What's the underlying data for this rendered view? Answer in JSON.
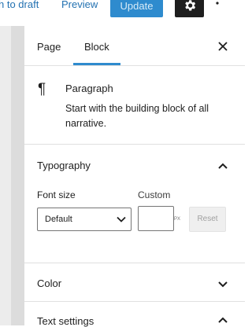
{
  "topbar": {
    "switch_to_draft": "h to draft",
    "preview": "Preview",
    "update": "Update",
    "settings_icon": "gear-icon",
    "more_icon": "vertical-ellipsis-icon"
  },
  "tabs": {
    "page": "Page",
    "block": "Block",
    "close_icon": "close-icon"
  },
  "block_card": {
    "icon": "paragraph-icon",
    "icon_glyph": "¶",
    "title": "Paragraph",
    "description": "Start with the building block of all narrative."
  },
  "typography": {
    "title": "Typography",
    "font_size_label": "Font size",
    "custom_label": "Custom",
    "font_size_value": "Default",
    "custom_unit": "PX",
    "reset": "Reset"
  },
  "color": {
    "title": "Color"
  },
  "text_settings": {
    "title": "Text settings"
  },
  "colors": {
    "accent": "#2e8bce",
    "link": "#2271b1",
    "dark": "#1e1e1e"
  }
}
